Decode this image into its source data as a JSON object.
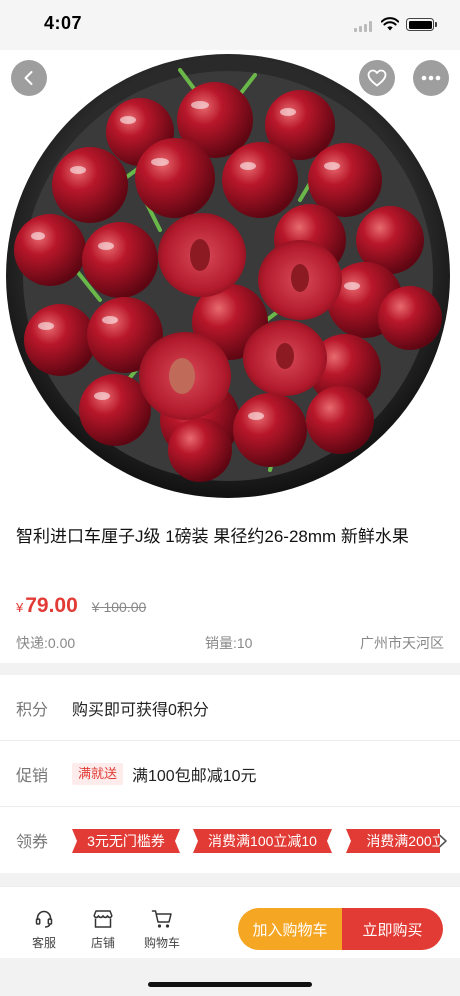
{
  "status_bar": {
    "time": "4:07"
  },
  "product": {
    "title": "智利进口车厘子J级 1磅装 果径约26-28mm 新鲜水果",
    "currency": "¥",
    "price": "79.00",
    "original_price": "¥ 100.00",
    "shipping": "快递:0.00",
    "sales": "销量:10",
    "location": "广州市天河区"
  },
  "points": {
    "label": "积分",
    "text": "购买即可获得0积分"
  },
  "promotion": {
    "label": "促销",
    "tag": "满就送",
    "text": "满100包邮减10元"
  },
  "coupons": {
    "label": "领券",
    "items": [
      "3元无门槛券",
      "消费满100立减10",
      "消费满200立"
    ]
  },
  "bottom_bar": {
    "service": "客服",
    "store": "店铺",
    "cart": "购物车",
    "add_to_cart": "加入购物车",
    "buy_now": "立即购买"
  },
  "icons": {
    "back": "back-arrow-icon",
    "favorite": "heart-icon",
    "more": "more-dots-icon",
    "service": "headset-icon",
    "store": "store-icon",
    "cart": "cart-icon",
    "coupon_more": "chevron-right-icon"
  },
  "colors": {
    "accent_red": "#e23b35",
    "accent_orange": "#f5a623",
    "tag_bg": "#fdeceb"
  }
}
